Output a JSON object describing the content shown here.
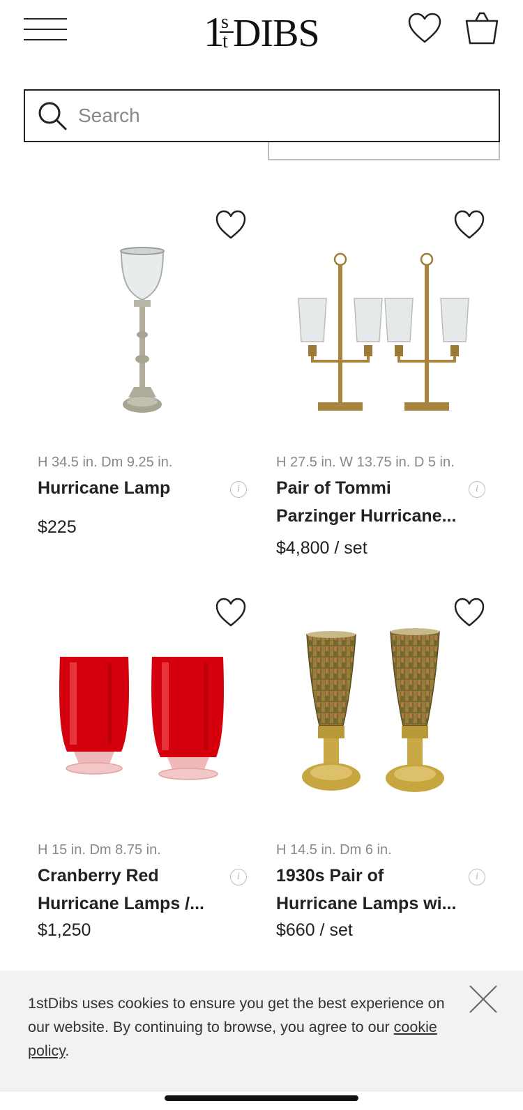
{
  "header": {
    "logo_text": "1stDIBS"
  },
  "search": {
    "placeholder": "Search",
    "value": ""
  },
  "products": [
    {
      "dims": "H 34.5 in. Dm 9.25 in.",
      "title": "Hurricane Lamp",
      "price": "$225",
      "image": "silver-hurricane-lamp"
    },
    {
      "dims": "H 27.5 in. W 13.75 in. D 5 in.",
      "title": "Pair of Tommi Parzinger Hurricane...",
      "price": "$4,800 / set",
      "image": "brass-double-hurricane-pair"
    },
    {
      "dims": "H 15 in. Dm 8.75 in.",
      "title": "Cranberry Red Hurricane Lamps /...",
      "price": "$1,250",
      "image": "red-glass-hurricane-pair"
    },
    {
      "dims": "H 14.5 in. Dm 6 in.",
      "title": "1930s Pair of Hurricane Lamps wi...",
      "price": "$660 / set",
      "image": "mosaic-hurricane-pair"
    }
  ],
  "info_glyph": "i",
  "cookie": {
    "text": "1stDibs uses cookies to ensure you get the best experience on our website. By continuing to browse, you agree to our ",
    "link": "cookie policy",
    "end": "."
  },
  "colors": {
    "text": "#222222",
    "muted": "#888888",
    "banner_bg": "#f2f2f2",
    "red_glass": "#d4000d",
    "brass": "#b08a3a"
  }
}
